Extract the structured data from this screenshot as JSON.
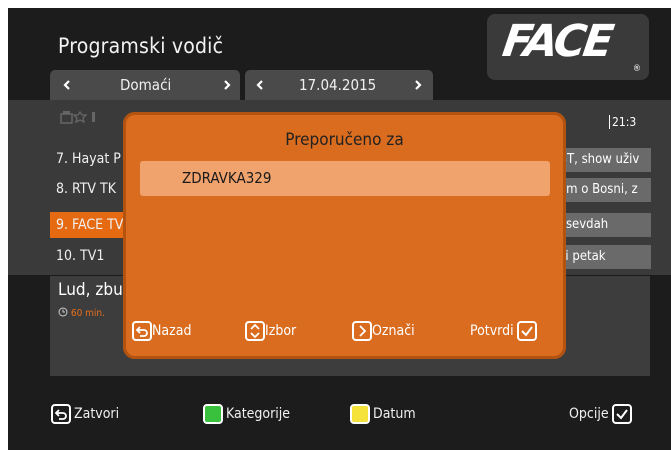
{
  "header": {
    "title": "Programski vodič"
  },
  "logo": {
    "text": "FACE",
    "reg": "®"
  },
  "selectors": {
    "category": "Domaći",
    "date": "17.04.2015"
  },
  "timeline": {
    "time": "21:3"
  },
  "channels": [
    {
      "label": "7. Hayat P",
      "program": "BT, show uživ"
    },
    {
      "label": "8. RTV TK",
      "program": "om o Bosni, z"
    },
    {
      "label": "9. FACE TV",
      "program": "i sevdah"
    },
    {
      "label": "10. TV1",
      "program": "ći petak"
    }
  ],
  "info": {
    "title": "Lud, zbu",
    "duration": "60 min."
  },
  "dialog": {
    "title": "Preporučeno za",
    "item": "ZDRAVKA329",
    "back": "Nazad",
    "select": "Izbor",
    "mark": "Označi",
    "confirm": "Potvrdi"
  },
  "bottom": {
    "close": "Zatvori",
    "categories": "Kategorije",
    "date": "Datum",
    "options": "Opcije"
  },
  "colors": {
    "accent": "#e66a12",
    "dialog": "#d96c1e",
    "green": "#39c13e",
    "yellow": "#f5e23a"
  }
}
